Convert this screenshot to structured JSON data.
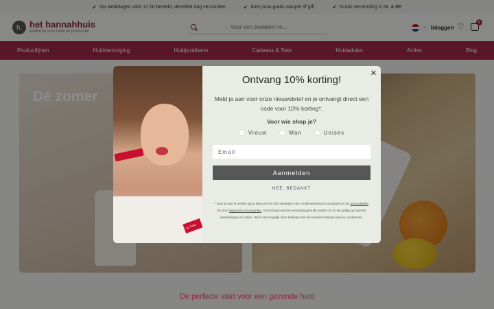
{
  "usp": [
    "Op werkdagen vóór 17.00 besteld, dezelfde dag verzonden",
    "Kies jouw gratis sample óf gift",
    "Gratis verzending in NL & BE"
  ],
  "header": {
    "logo_mark": "h.",
    "logo_text": "het hannahhuis",
    "logo_sub": "webshop voor hannah producten",
    "search_placeholder": "Voor een zoekterm in...",
    "login": "Inloggen",
    "cart_count": "0"
  },
  "nav": [
    "Productlijnen",
    "Huidverzorging",
    "Huidprobleem",
    "Cadeaus & Sets",
    "Huidadvies",
    "Acties",
    "Blog"
  ],
  "hero": {
    "title": "Dé zomer"
  },
  "subheading": "De perfecte start voor een gezonde huid",
  "modal": {
    "title": "Ontvang 10% korting!",
    "text": "Meld je aan voor onze nieuwsbrief en je ontvangt direct een code voor 10% korting*.",
    "question": "Voor wie shop je?",
    "options": [
      "Vrouw",
      "Man",
      "Unisex"
    ],
    "email_placeholder": "Email",
    "submit": "Aanmelden",
    "decline": "NEE, BEDANKT",
    "fine_1": "* Door je aan te melden ga je akkoord met het ontvangen van e-mailmarketing en accepteer je ons",
    "fine_link_1": "privacybeleid",
    "fine_2": "en onze",
    "fine_link_2": "algemene voorwaarden",
    "fine_3": ". De kortingscode kan eenmalig gebruikt worden en is niet geldig op lopende aanbiedingen en acties. Het is niet mogelijk deze kortingscode met andere kortingscodes te combineren.",
    "photo_tag": "Lip Treat"
  },
  "colors": {
    "brand": "#a3284f",
    "button": "#575757",
    "modal_bg": "#e9ece5"
  }
}
